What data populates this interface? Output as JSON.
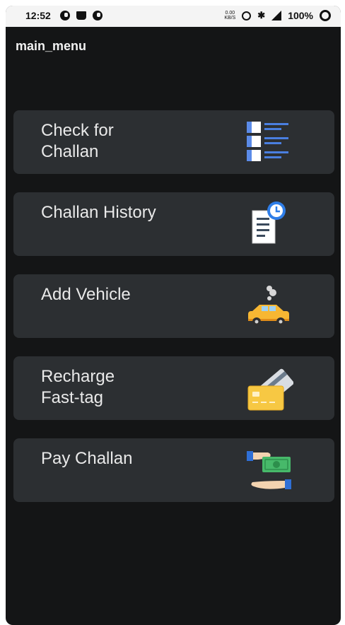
{
  "status_bar": {
    "time": "12:52",
    "net_speed": "0.00\nKB/S",
    "battery": "100%"
  },
  "app": {
    "title": "main_menu"
  },
  "menu": [
    {
      "label": "Check for\nChallan",
      "icon": "checklist-icon"
    },
    {
      "label": "Challan History",
      "icon": "history-document-icon"
    },
    {
      "label": "Add Vehicle",
      "icon": "car-icon"
    },
    {
      "label": "Recharge\nFast-tag",
      "icon": "card-icon"
    },
    {
      "label": "Pay Challan",
      "icon": "cash-payment-icon"
    }
  ],
  "colors": {
    "background": "#141516",
    "card": "#2c2f32",
    "text": "#e9e9e9"
  }
}
